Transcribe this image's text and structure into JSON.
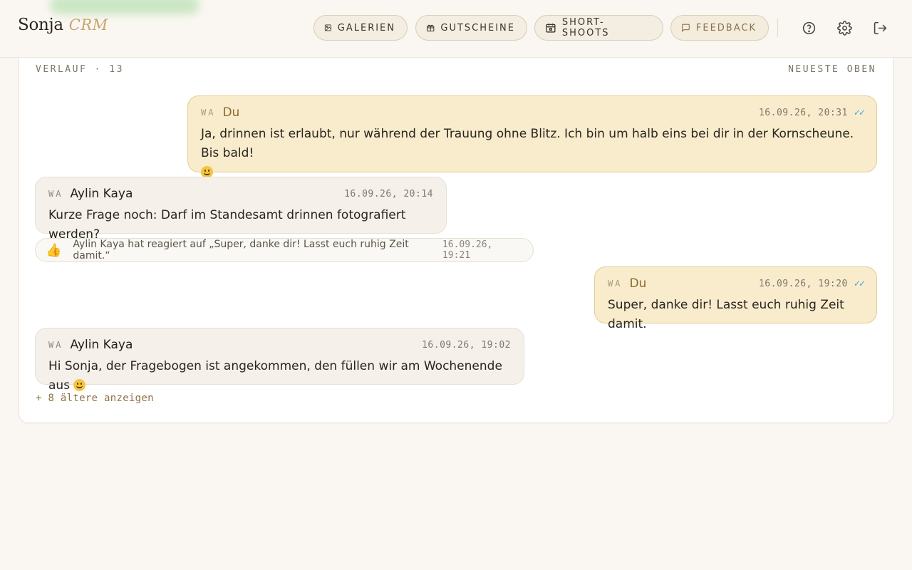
{
  "brand": {
    "name": "Sonja",
    "sub": "CRM"
  },
  "nav": {
    "galerien": "GALERIEN",
    "gutscheine": "GUTSCHEINE",
    "short_shoots": "SHORT-SHOOTS",
    "feedback": "FEEDBACK"
  },
  "history": {
    "title": "VERLAUF · 13",
    "sort": "NEUESTE OBEN",
    "show_older": "+ 8 ältere anzeigen"
  },
  "messages": [
    {
      "source": "WA",
      "author": "Du",
      "timestamp": "16.09.26, 20:31",
      "read": "✓✓",
      "text": "Ja, drinnen ist erlaubt, nur während der Trauung ohne Blitz. Ich bin um halb eins bei dir in der Kornscheune. Bis bald!"
    },
    {
      "source": "WA",
      "author": "Aylin Kaya",
      "timestamp": "16.09.26, 20:14",
      "text": "Kurze Frage noch: Darf im Standesamt drinnen fotografiert werden?"
    },
    {
      "source": "WA",
      "author": "Du",
      "timestamp": "16.09.26, 19:20",
      "read": "✓✓",
      "text": "Super, danke dir! Lasst euch ruhig Zeit damit."
    },
    {
      "source": "WA",
      "author": "Aylin Kaya",
      "timestamp": "16.09.26, 19:02",
      "text": "Hi Sonja, der Fragebogen ist angekommen, den füllen wir am Wochenende aus"
    }
  ],
  "reaction": {
    "icon": "👍",
    "text": "Aylin Kaya hat reagiert auf „Super, danke dir! Lasst euch ruhig Zeit damit.“",
    "timestamp": "16.09.26, 19:21"
  },
  "colors": {
    "accent": "#c8a46a",
    "outgoing_bg": "#f8eccd",
    "incoming_bg": "#f5f1ea",
    "read_tick": "#4aa8d8"
  }
}
